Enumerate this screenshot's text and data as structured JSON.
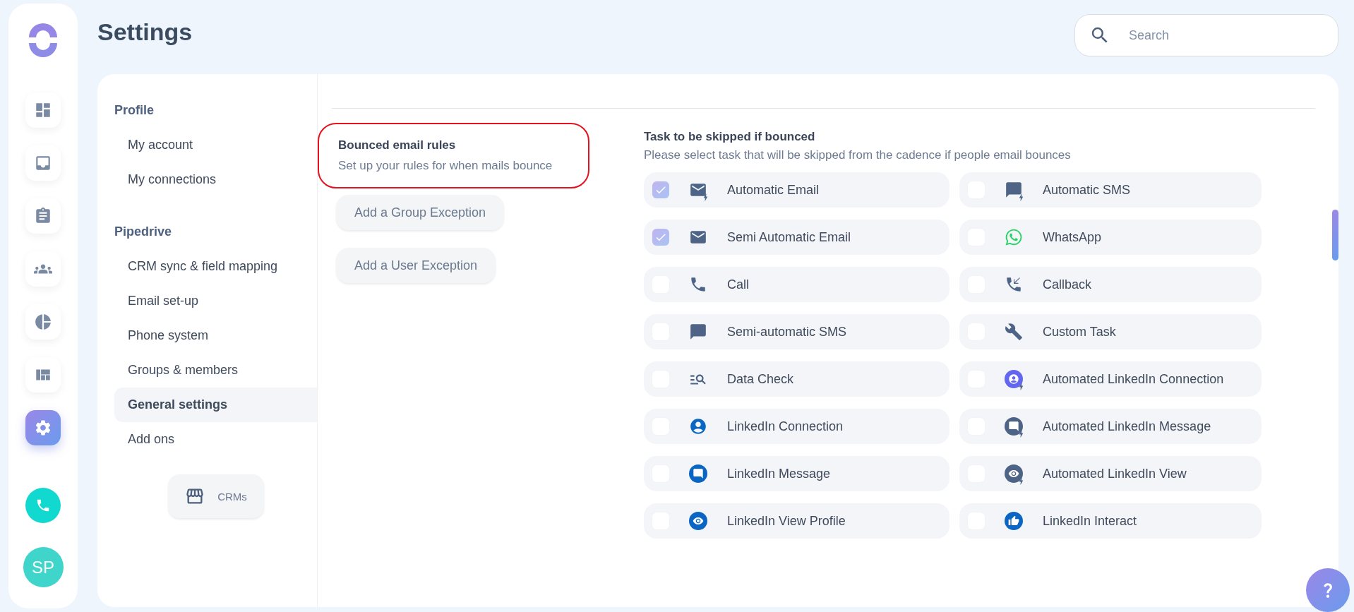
{
  "rail": {
    "items": [
      {
        "selected": false
      },
      {
        "selected": false
      },
      {
        "selected": false
      },
      {
        "selected": false
      },
      {
        "selected": false
      },
      {
        "selected": false
      },
      {
        "selected": true
      }
    ],
    "avatar": "SP"
  },
  "title": "Settings",
  "search": {
    "placeholder": "Search"
  },
  "nav": {
    "sections": [
      {
        "heading": "Profile",
        "items": [
          {
            "label": "My account",
            "selected": false
          },
          {
            "label": "My connections",
            "selected": false
          }
        ]
      },
      {
        "heading": "Pipedrive",
        "items": [
          {
            "label": "CRM sync & field mapping",
            "selected": false
          },
          {
            "label": "Email set-up",
            "selected": false
          },
          {
            "label": "Phone system",
            "selected": false
          },
          {
            "label": "Groups & members",
            "selected": false
          },
          {
            "label": "General settings",
            "selected": true
          },
          {
            "label": "Add ons",
            "selected": false
          }
        ]
      }
    ],
    "crm_button": "CRMs"
  },
  "rules": {
    "title": "Bounced email rules",
    "subtitle": "Set up your rules for when mails bounce",
    "buttons": [
      "Add a Group Exception",
      "Add a User Exception"
    ]
  },
  "tasks": {
    "title": "Task to be skipped if bounced",
    "subtitle": "Please select task that will be skipped from the cadence if people email bounces",
    "items": [
      {
        "label": "Automatic Email",
        "kind": "mail",
        "auto": true,
        "checked": true
      },
      {
        "label": "Automatic SMS",
        "kind": "sms",
        "auto": true,
        "checked": false
      },
      {
        "label": "Semi Automatic Email",
        "kind": "mail",
        "auto": false,
        "checked": true
      },
      {
        "label": "WhatsApp",
        "kind": "whatsapp",
        "auto": false,
        "checked": false
      },
      {
        "label": "Call",
        "kind": "call",
        "auto": false,
        "checked": false
      },
      {
        "label": "Callback",
        "kind": "callback",
        "auto": false,
        "checked": false
      },
      {
        "label": "Semi-automatic SMS",
        "kind": "sms",
        "auto": false,
        "checked": false
      },
      {
        "label": "Custom Task",
        "kind": "wrench",
        "auto": false,
        "checked": false
      },
      {
        "label": "Data Check",
        "kind": "data",
        "auto": false,
        "checked": false
      },
      {
        "label": "Automated LinkedIn Connection",
        "kind": "person",
        "auto": true,
        "checked": false
      },
      {
        "label": "LinkedIn Connection",
        "kind": "person",
        "auto": false,
        "checked": false
      },
      {
        "label": "Automated LinkedIn Message",
        "kind": "message",
        "auto": true,
        "checked": false
      },
      {
        "label": "LinkedIn Message",
        "kind": "message",
        "auto": false,
        "checked": false
      },
      {
        "label": "Automated LinkedIn View",
        "kind": "view",
        "auto": true,
        "checked": false
      },
      {
        "label": "LinkedIn View Profile",
        "kind": "view",
        "auto": false,
        "checked": false
      },
      {
        "label": "LinkedIn Interact",
        "kind": "like",
        "auto": false,
        "checked": false
      }
    ]
  }
}
